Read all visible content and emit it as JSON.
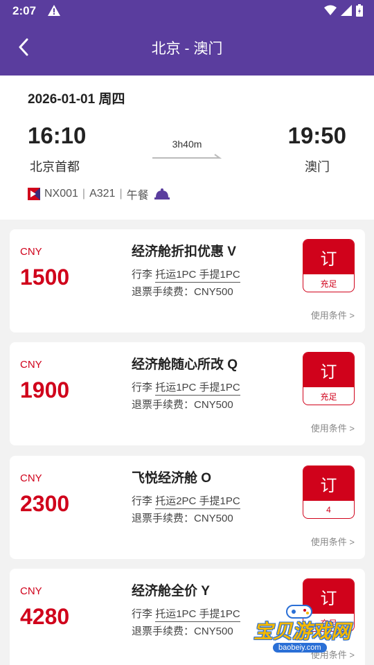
{
  "status_bar": {
    "time": "2:07"
  },
  "header": {
    "title": "北京 - 澳门"
  },
  "flight": {
    "date": "2026-01-01 周四",
    "departure_time": "16:10",
    "departure_city": "北京首都",
    "arrival_time": "19:50",
    "arrival_city": "澳门",
    "duration": "3h40m",
    "flight_number": "NX001",
    "aircraft": "A321",
    "meal": "午餐"
  },
  "fares": [
    {
      "currency": "CNY",
      "price": "1500",
      "name": "经济舱折扣优惠 V",
      "baggage_label": "行李",
      "baggage_detail": "托运1PC 手提1PC",
      "refund": "退票手续费：CNY500",
      "book_label": "订",
      "availability": "充足",
      "terms": "使用条件 >"
    },
    {
      "currency": "CNY",
      "price": "1900",
      "name": "经济舱随心所改 Q",
      "baggage_label": "行李",
      "baggage_detail": "托运1PC 手提1PC",
      "refund": "退票手续费：CNY500",
      "book_label": "订",
      "availability": "充足",
      "terms": "使用条件 >"
    },
    {
      "currency": "CNY",
      "price": "2300",
      "name": "飞悦经济舱 O",
      "baggage_label": "行李",
      "baggage_detail": "托运2PC 手提1PC",
      "refund": "退票手续费：CNY500",
      "book_label": "订",
      "availability": "4",
      "terms": "使用条件 >"
    },
    {
      "currency": "CNY",
      "price": "4280",
      "name": "经济舱全价 Y",
      "baggage_label": "行李",
      "baggage_detail": "托运1PC 手提1PC",
      "refund": "退票手续费：CNY500",
      "book_label": "订",
      "availability": "充足",
      "terms": "使用条件 >"
    }
  ],
  "watermark": {
    "text": "宝贝游戏网",
    "url": "baobeiy.com"
  },
  "colors": {
    "header": "#5a3d9e",
    "accent": "#d0021b",
    "background": "#f2f2f2"
  }
}
